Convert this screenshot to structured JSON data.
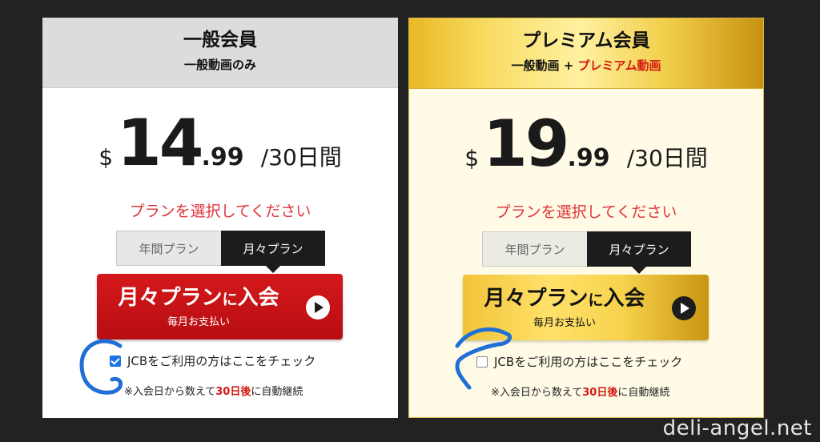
{
  "plans": [
    {
      "title": "一般会員",
      "subtitle": "一般動画のみ",
      "currency": "$",
      "price_int": "14",
      "price_dec": ".99",
      "period": "/30日間",
      "choose_text": "プランを選択してください",
      "tab_yearly": "年間プラン",
      "tab_monthly": "月々プラン",
      "join_main": "月々プラン",
      "join_small": "に",
      "join_end": "入会",
      "join_sub": "毎月お支払い",
      "jcb_label": "JCBをご利用の方はここをチェック",
      "jcb_checked": true,
      "note_prefix": "※入会日から数えて",
      "note_highlight": "30日後",
      "note_suffix": "に自動継続"
    },
    {
      "title": "プレミアム会員",
      "subtitle_a": "一般動画 + ",
      "subtitle_b": "プレミアム動画",
      "currency": "$",
      "price_int": "19",
      "price_dec": ".99",
      "period": "/30日間",
      "choose_text": "プランを選択してください",
      "tab_yearly": "年間プラン",
      "tab_monthly": "月々プラン",
      "join_main": "月々プラン",
      "join_small": "に",
      "join_end": "入会",
      "join_sub": "毎月お支払い",
      "jcb_label": "JCBをご利用の方はここをチェック",
      "jcb_checked": false,
      "note_prefix": "※入会日から数えて",
      "note_highlight": "30日後",
      "note_suffix": "に自動継続"
    }
  ],
  "colors": {
    "background": "#222222",
    "general_header": "#dcdcdc",
    "premium_gold": "#f2cf4c",
    "accent_red": "#d3180f",
    "scribble_blue": "#1f6fd6"
  },
  "watermark": "deli-angel.net"
}
